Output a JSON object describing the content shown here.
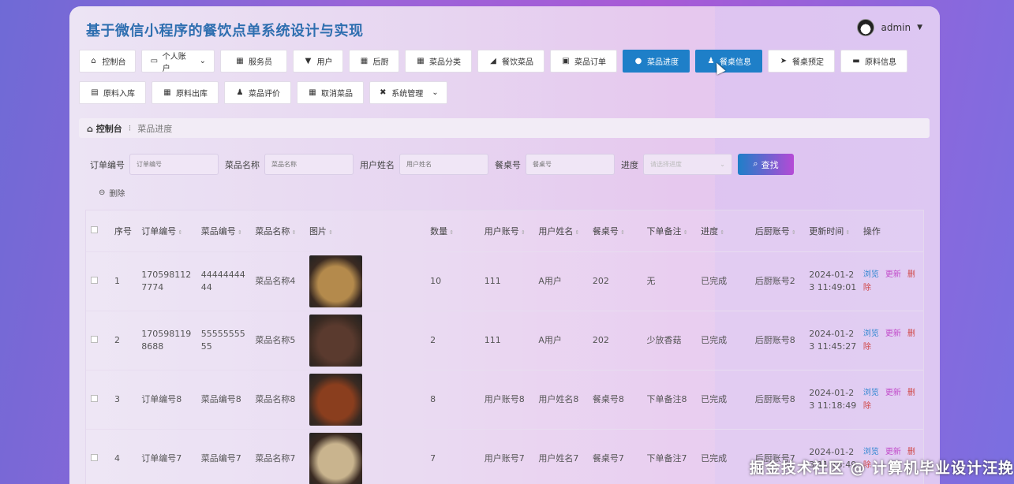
{
  "header": {
    "title": "基于微信小程序的餐饮点单系统设计与实现",
    "user_name": "admin"
  },
  "nav": {
    "row1": [
      {
        "label": "控制台",
        "icon": "home-icon"
      },
      {
        "label": "个人账户",
        "icon": "account-icon",
        "dropdown": true
      },
      {
        "label": "服务员",
        "icon": "grid-icon"
      },
      {
        "label": "用户",
        "icon": "pin-icon"
      },
      {
        "label": "后厨",
        "icon": "grid-icon"
      },
      {
        "label": "菜品分类",
        "icon": "grid-icon"
      },
      {
        "label": "餐饮菜品",
        "icon": "dish-icon"
      },
      {
        "label": "菜品订单",
        "icon": "clipboard-icon"
      },
      {
        "label": "菜品进度",
        "icon": "bulb-icon",
        "active": true
      },
      {
        "label": "餐桌信息",
        "icon": "person-icon",
        "active": true
      },
      {
        "label": "餐桌预定",
        "icon": "send-icon"
      },
      {
        "label": "原料信息",
        "icon": "monitor-icon"
      }
    ],
    "row2": [
      {
        "label": "原料入库",
        "icon": "briefcase-icon"
      },
      {
        "label": "原料出库",
        "icon": "grid-icon"
      },
      {
        "label": "菜品评价",
        "icon": "person-icon"
      },
      {
        "label": "取消菜品",
        "icon": "grid-icon"
      },
      {
        "label": "系统管理",
        "icon": "gamepad-icon",
        "dropdown": true
      }
    ]
  },
  "breadcrumb": {
    "home": "控制台",
    "separator": "⁝",
    "current": "菜品进度"
  },
  "search": {
    "fields": [
      {
        "label": "订单编号",
        "placeholder": "订单编号"
      },
      {
        "label": "菜品名称",
        "placeholder": "菜品名称"
      },
      {
        "label": "用户姓名",
        "placeholder": "用户姓名"
      },
      {
        "label": "餐桌号",
        "placeholder": "餐桌号"
      }
    ],
    "progress_label": "进度",
    "progress_placeholder": "请选择进度",
    "button": "查找"
  },
  "delete_label": "删除",
  "table": {
    "headers": [
      "序号",
      "订单编号",
      "菜品编号",
      "菜品名称",
      "图片",
      "数量",
      "用户账号",
      "用户姓名",
      "餐桌号",
      "下单备注",
      "进度",
      "后厨账号",
      "更新时间",
      "操作"
    ],
    "actions": {
      "view": "浏览",
      "edit": "更新",
      "delete": "删除"
    },
    "rows": [
      {
        "idx": "1",
        "order_no": "1705981127774",
        "dish_no": "4444444444",
        "dish_name": "菜品名称4",
        "qty": "10",
        "user_acct": "111",
        "user_name": "A用户",
        "table_no": "202",
        "note": "无",
        "progress": "已完成",
        "kitchen": "后厨账号2",
        "updated": "2024-01-23 11:49:01",
        "image_color": "#b48a4c"
      },
      {
        "idx": "2",
        "order_no": "1705981198688",
        "dish_no": "5555555555",
        "dish_name": "菜品名称5",
        "qty": "2",
        "user_acct": "111",
        "user_name": "A用户",
        "table_no": "202",
        "note": "少放香菇",
        "progress": "已完成",
        "kitchen": "后厨账号8",
        "updated": "2024-01-23 11:45:27",
        "image_color": "#5a3a2e"
      },
      {
        "idx": "3",
        "order_no": "订单编号8",
        "dish_no": "菜品编号8",
        "dish_name": "菜品名称8",
        "qty": "8",
        "user_acct": "用户账号8",
        "user_name": "用户姓名8",
        "table_no": "餐桌号8",
        "note": "下单备注8",
        "progress": "已完成",
        "kitchen": "后厨账号8",
        "updated": "2024-01-23 11:18:49",
        "image_color": "#8a3e1e"
      },
      {
        "idx": "4",
        "order_no": "订单编号7",
        "dish_no": "菜品编号7",
        "dish_name": "菜品名称7",
        "qty": "7",
        "user_acct": "用户账号7",
        "user_name": "用户姓名7",
        "table_no": "餐桌号7",
        "note": "下单备注7",
        "progress": "已完成",
        "kitchen": "后厨账号7",
        "updated": "2024-01-23 11:18:49",
        "image_color": "#c9b48e"
      }
    ]
  },
  "watermark": "掘金技术社区 @ 计算机毕业设计汪挽"
}
